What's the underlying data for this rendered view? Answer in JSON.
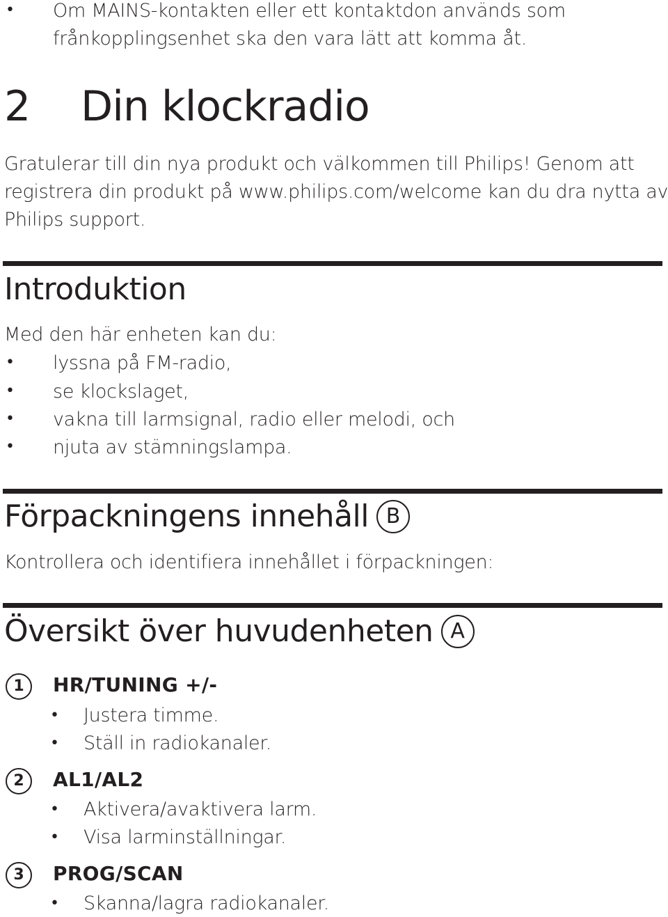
{
  "top_bullet": {
    "lines": [
      "Om MAINS-kontakten eller ett kontaktdon används som",
      "frånkopplingsenhet ska den vara lätt att komma åt."
    ],
    "marker": "•"
  },
  "chapter": {
    "number": "2",
    "title": "Din klockradio",
    "intro_lines": [
      "Gratulerar till din nya produkt och välkommen till Philips! Genom att",
      "registrera din produkt på www.philips.com/welcome kan du dra nytta av",
      "Philips support."
    ]
  },
  "introduction": {
    "heading": "Introduktion",
    "lead": "Med den här enheten kan du:",
    "bullets": [
      "lyssna på FM-radio,",
      "se klockslaget,",
      "vakna till larmsignal, radio eller melodi, och",
      "njuta av stämningslampa."
    ],
    "marker": "•"
  },
  "package": {
    "heading": "Förpackningens innehåll",
    "badge": "B",
    "text": "Kontrollera och identifiera innehållet i förpackningen:"
  },
  "overview": {
    "heading": "Översikt över huvudenheten",
    "badge": "A",
    "items": [
      {
        "num": "1",
        "title": "HR/TUNING +/-",
        "bullets": [
          "Justera timme.",
          "Ställ in radiokanaler."
        ]
      },
      {
        "num": "2",
        "title": "AL1/AL2",
        "bullets": [
          "Aktivera/avaktivera larm.",
          "Visa larminställningar."
        ]
      },
      {
        "num": "3",
        "title": "PROG/SCAN",
        "bullets": [
          "Skanna/lagra radiokanaler."
        ]
      }
    ],
    "marker": "•"
  }
}
